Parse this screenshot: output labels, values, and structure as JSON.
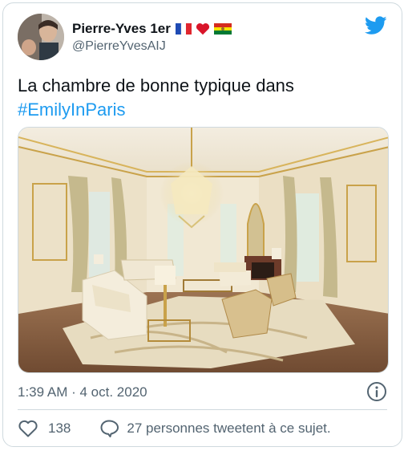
{
  "author": {
    "display_name": "Pierre-Yves 1er",
    "handle": "@PierreYvesAIJ",
    "flag_icons": [
      "france-flag-icon",
      "red-heart-icon",
      "bolivia-flag-icon"
    ]
  },
  "tweet": {
    "text": "La chambre de bonne typique dans",
    "hashtag": "#EmilyInParis",
    "media_description_icon": "photo-icon",
    "timestamp": "1:39 AM · 4 oct. 2020"
  },
  "actions": {
    "likes": "138",
    "retweet_text": "27 personnes tweetent à ce sujet."
  },
  "colors": {
    "accent": "#1d9bf0",
    "secondary_text": "#536471",
    "heart": "#e0245e",
    "border": "#cfd9de"
  }
}
